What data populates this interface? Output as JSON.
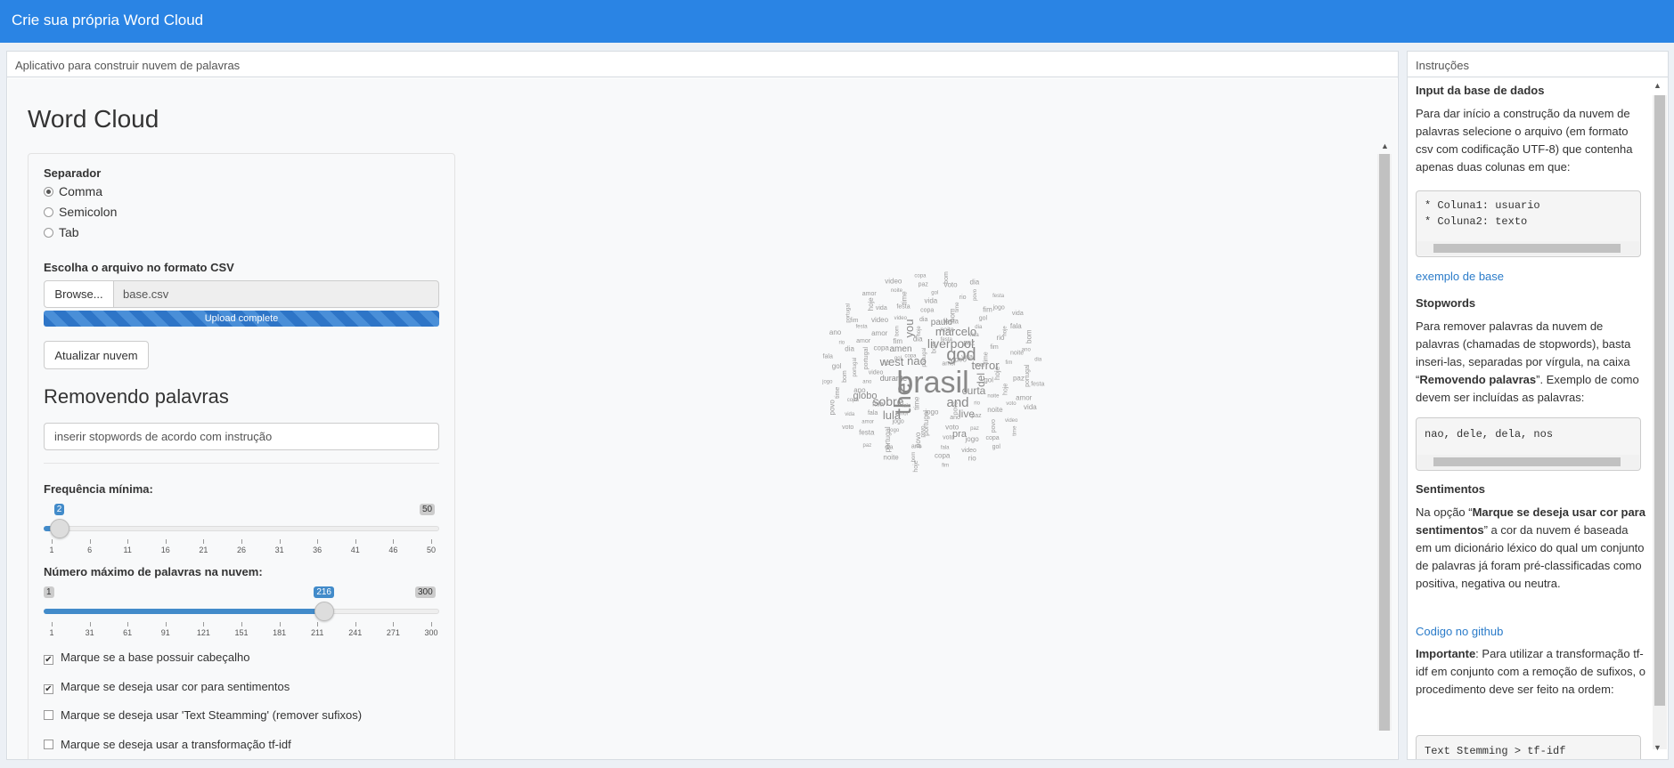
{
  "app": {
    "title": "Crie sua própria Word Cloud"
  },
  "main_box": {
    "header": "Aplicativo para construir nuvem de palavras"
  },
  "instructions_box": {
    "header": "Instruções"
  },
  "word_cloud": {
    "title": "Word Cloud",
    "separator": {
      "label": "Separador",
      "options": [
        "Comma",
        "Semicolon",
        "Tab"
      ],
      "selected": "Comma"
    },
    "file": {
      "label": "Escolha o arquivo no formato CSV",
      "browse_label": "Browse...",
      "filename": "base.csv",
      "status": "Upload complete",
      "progress": 1.0
    },
    "update_button": "Atualizar nuvem",
    "stopwords": {
      "title": "Removendo palavras",
      "value": "inserir stopwords de acordo com instrução"
    },
    "min_freq": {
      "label": "Frequência mínima:",
      "min": 1,
      "max": 50,
      "value": 2,
      "min_label": "1",
      "max_label": "50",
      "value_label": "2",
      "ticks": [
        "1",
        "6",
        "11",
        "16",
        "21",
        "26",
        "31",
        "36",
        "41",
        "46",
        "50"
      ]
    },
    "max_words": {
      "label": "Número máximo de palavras na nuvem:",
      "min": 1,
      "max": 300,
      "value": 216,
      "min_label": "1",
      "max_label": "300",
      "value_label": "216",
      "ticks": [
        "1",
        "31",
        "61",
        "91",
        "121",
        "151",
        "181",
        "211",
        "241",
        "271",
        "300"
      ]
    },
    "checkboxes": [
      {
        "label": "Marque se a base possuir cabeçalho",
        "checked": true
      },
      {
        "label": "Marque se deseja usar cor para sentimentos",
        "checked": true
      },
      {
        "label": "Marque se deseja usar 'Text Steamming' (remover sufixos)",
        "checked": false
      },
      {
        "label": "Marque se deseja usar a transformação tf-idf",
        "checked": false
      }
    ],
    "cloud_words": [
      "brasil",
      "the",
      "god",
      "liverpool",
      "west",
      "nao",
      "and",
      "curta",
      "sobre",
      "lula",
      "marcelo",
      "you",
      "del",
      "terror",
      "live",
      "globo",
      "paulo",
      "pra",
      "amen",
      "durante"
    ]
  },
  "instructions": {
    "input_title": "Input da base de dados",
    "input_text": "Para dar início a construção da nuvem de palavras selecione o arquivo (em formato csv com codificação UTF-8) que contenha apenas duas colunas em que:",
    "code1": [
      "* Coluna1: usuario",
      "* Coluna2: texto"
    ],
    "example_link": "exemplo de base",
    "stopwords_title": "Stopwords",
    "stopwords_text_1": "Para remover palavras da nuvem de palavras (chamadas de stopwords), basta inseri-las, separadas por vírgula, na caixa “",
    "stopwords_bold": "Removendo palavras",
    "stopwords_text_2": "”. Exemplo de como devem ser incluídas as palavras:",
    "code2": "nao, dele, dela, nos",
    "sentiment_title": "Sentimentos",
    "sentiment_text_1": "Na opção “",
    "sentiment_bold": "Marque se deseja usar cor para sentimentos",
    "sentiment_text_2": "” a cor da nuvem é baseada em um dicionário léxico do qual um conjunto de palavras já foram pré-classificadas como positiva, negativa ou neutra.",
    "github_link": "Codigo no github",
    "important_bold": "Importante",
    "important_text": ": Para utilizar a transformação tf-idf em conjunto com a remoção de sufixos, o procedimento deve ser feito na ordem:",
    "code3": "Text Stemming > tf-idf"
  }
}
